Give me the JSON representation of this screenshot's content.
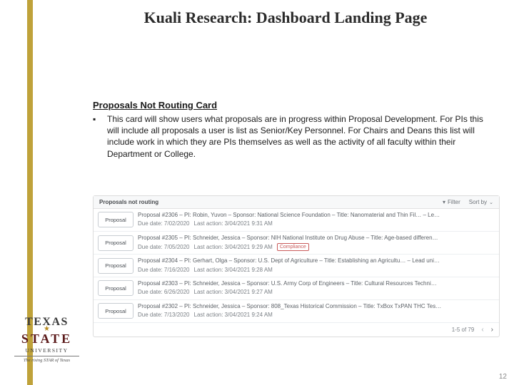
{
  "slide": {
    "title": "Kuali Research: Dashboard Landing Page",
    "section_heading": "Proposals Not Routing Card",
    "bullet": "This card will show users what proposals are in progress within Proposal Development. For PIs this will include all proposals a user is list as Senior/Key Personnel. For Chairs and Deans this list will include work in which they are PIs themselves as well as the activity of all faculty within their Department or College.",
    "page_number": "12"
  },
  "card": {
    "title": "Proposals not routing",
    "filter_label": "Filter",
    "sort_label": "Sort by",
    "button_label": "Proposal",
    "rows": [
      {
        "line1": "Proposal #2306 – PI: Robin, Yuvon – Sponsor: National Science Foundation – Title: Nanomaterial and Thin Fil… – Le…",
        "due": "Due date: 7/02/2020",
        "last": "Last action: 3/04/2021 9:31 AM",
        "badge": ""
      },
      {
        "line1": "Proposal #2305 – PI: Schneider, Jessica – Sponsor: NIH National Institute on Drug Abuse – Title: Age-based differen…",
        "due": "Due date: 7/05/2020",
        "last": "Last action: 3/04/2021 9:29 AM",
        "badge": "Compliance"
      },
      {
        "line1": "Proposal #2304 – PI: Gerhart, Olga – Sponsor: U.S. Dept of Agriculture – Title: Establishing an Agricultu… – Lead uni…",
        "due": "Due date: 7/16/2020",
        "last": "Last action: 3/04/2021 9:28 AM",
        "badge": ""
      },
      {
        "line1": "Proposal #2303 – PI: Schneider, Jessica – Sponsor: U.S. Army Corp of Engineers – Title: Cultural Resources Techni…",
        "due": "Due date: 6/26/2020",
        "last": "Last action: 3/04/2021 9:27 AM",
        "badge": ""
      },
      {
        "line1": "Proposal #2302 – PI: Schneider, Jessica – Sponsor: 808_Texas Historical Commission – Title: TxBox TxPAN THC Tes…",
        "due": "Due date: 7/13/2020",
        "last": "Last action: 3/04/2021 9:24 AM",
        "badge": ""
      }
    ],
    "pagination": "1-5 of 79"
  },
  "logo": {
    "line1": "TEXAS",
    "line2": "STATE",
    "univ": "UNIVERSITY",
    "tag": "The rising STAR of Texas"
  }
}
